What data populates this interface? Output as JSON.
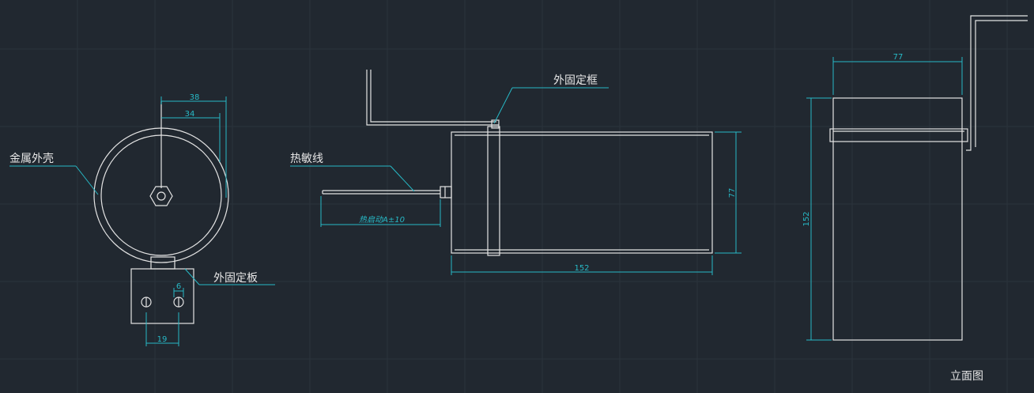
{
  "colors": {
    "background": "#212830",
    "grid": "#2b333c",
    "outline": "#e4e4e4",
    "dimension": "#27b9c6",
    "leader": "#2ab9a6"
  },
  "view_title": "立面图",
  "front_view": {
    "labels": {
      "metal_shell": "金属外壳",
      "fixing_plate": "外固定板"
    },
    "dims": {
      "outer_diameter": "38",
      "inner_diameter": "34",
      "hole_offset": "6",
      "hole_spacing": "19"
    }
  },
  "side_view": {
    "labels": {
      "fixing_frame": "外固定框",
      "thermal_wire": "热敏线"
    },
    "dims": {
      "wire_length": "热启动A±10",
      "height": "77",
      "length": "152"
    }
  },
  "end_view": {
    "dims": {
      "width": "77",
      "height": "152"
    }
  }
}
